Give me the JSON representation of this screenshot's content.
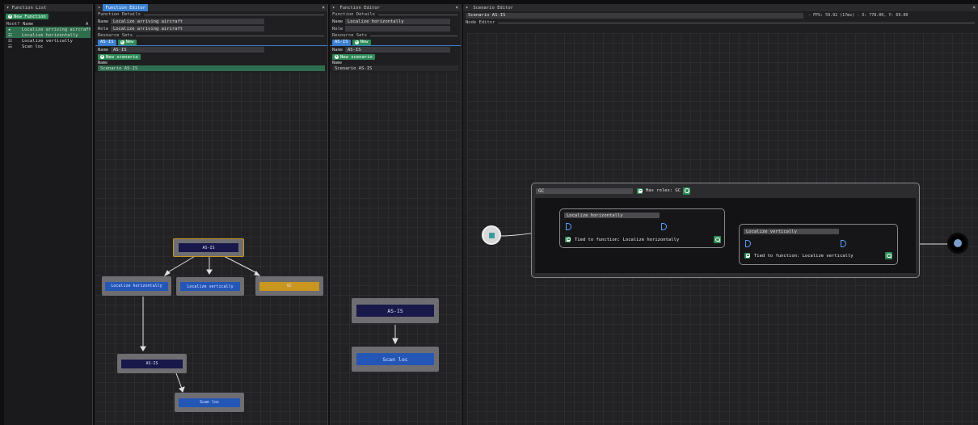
{
  "function_list": {
    "title": "Function List",
    "new_button": "New Function",
    "col_root": "Root?",
    "col_name": "Name",
    "col_a": "A",
    "items": [
      {
        "name": "Localize arriving aircraft",
        "root": true,
        "selected": true
      },
      {
        "name": "Localize horizontally",
        "root": false,
        "selected": true
      },
      {
        "name": "Localize vertically",
        "root": false,
        "selected": false
      },
      {
        "name": "Scan loc",
        "root": false,
        "selected": false
      }
    ]
  },
  "editor1": {
    "title": "Function Editor",
    "close": "×",
    "details_header": "Function Details",
    "name_label": "Name",
    "name_value": "Localize arriving aircraft",
    "role_label": "Role",
    "role_value": "Localize arriving aircraft",
    "resource_header": "Resource Sets",
    "as_is": "AS-IS",
    "new": "New",
    "set_name_label": "Name",
    "set_name_value": "AS-IS",
    "new_scenario": "New scenario",
    "scen_col": "Name",
    "scenario": "Scenario AS-IS",
    "graph": {
      "root": "AS-IS",
      "c1": "Localize horizontally",
      "c2": "Localize vertically",
      "c3": "GC",
      "sub": "AS-IS",
      "leaf": "Scan loc"
    }
  },
  "editor2": {
    "title": "Function Editor",
    "close": "×",
    "details_header": "Function Details",
    "name_label": "Name",
    "name_value": "Localize horizontally",
    "role_label": "Role",
    "role_value": "",
    "resource_header": "Resource Sets",
    "as_is": "AS-IS",
    "new": "New",
    "set_name_label": "Name",
    "set_name_value": "AS-IS",
    "new_scenario": "New scenario",
    "scen_col": "Name",
    "scenario": "Scenario AS-IS",
    "graph": {
      "root": "AS-IS",
      "leaf": "Scan loc"
    }
  },
  "scenario_editor": {
    "title": "Scenario Editor",
    "close": "×",
    "scenario_name": "Scenario AS-IS",
    "stats": "- FPS: 59.92 (17ms) - X: 778.00, Y: 69.00",
    "node_editor_header": "Node Editor",
    "group_name": "GC",
    "has_roles": "Has roles: GC",
    "node_h_title": "Localize horizontally",
    "node_h_tied": "Tied to function: Localize horizontally",
    "node_v_title": "Localize vertically",
    "node_v_tied": "Tied to function: Localize vertically"
  }
}
